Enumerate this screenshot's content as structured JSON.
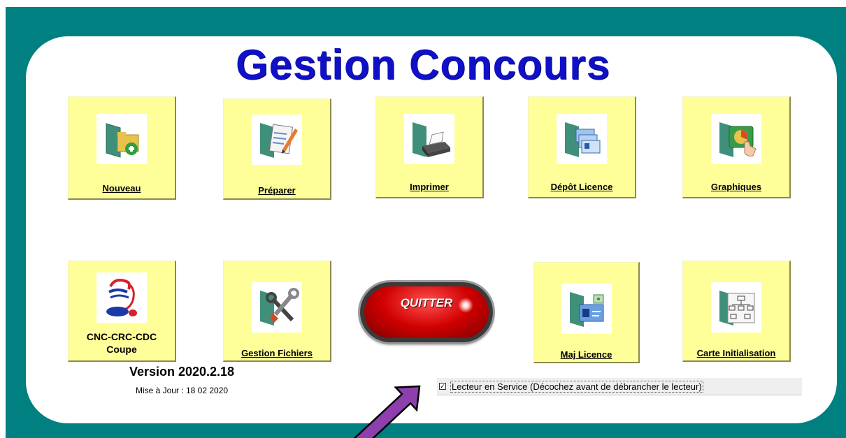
{
  "app": {
    "title": "Gestion Concours",
    "version": "Version 2020.2.18",
    "update_date": "Mise à Jour : 18 02 2020"
  },
  "tiles": {
    "nouveau": {
      "label": "Nouveau",
      "icon": "folder-add-icon"
    },
    "preparer": {
      "label": "Préparer",
      "icon": "edit-document-icon"
    },
    "imprimer": {
      "label": "Imprimer",
      "icon": "printer-icon"
    },
    "depot_licence": {
      "label": "Dépôt Licence",
      "icon": "licence-cards-icon"
    },
    "graphiques": {
      "label": "Graphiques",
      "icon": "chart-touch-icon"
    },
    "cnc": {
      "label_line1": "CNC-CRC-CDC",
      "label_line2": "Coupe",
      "icon": "rooster-france-logo"
    },
    "gestion_fichiers": {
      "label": "Gestion Fichiers",
      "icon": "tools-icon"
    },
    "maj_licence": {
      "label": "Maj Licence",
      "icon": "card-reader-icon"
    },
    "carte_init": {
      "label": "Carte Initialisation",
      "icon": "tree-diagram-icon"
    }
  },
  "quit_button": {
    "label": "QUITTER"
  },
  "reader_checkbox": {
    "checked": true,
    "label": "Lecteur en Service (Décochez avant de débrancher le lecteur)"
  },
  "colors": {
    "background": "#008080",
    "panel": "#ffffff",
    "tile": "#ffff99",
    "title": "#1010c8",
    "quit": "#d00000",
    "arrow": "#8e3fae"
  }
}
